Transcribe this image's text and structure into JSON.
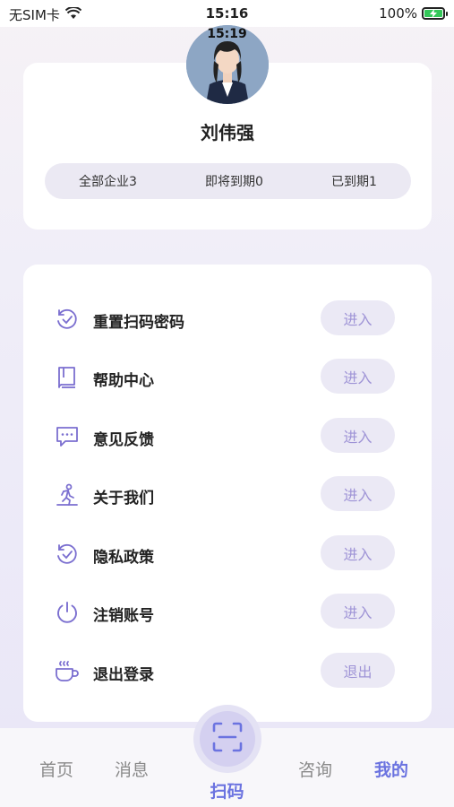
{
  "status_bar": {
    "carrier": "无SIM卡",
    "time": "15:16",
    "battery": "100%"
  },
  "profile": {
    "overlay_time": "15:19",
    "name": "刘伟强",
    "stats": [
      {
        "label": "全部企业3"
      },
      {
        "label": "即将到期0"
      },
      {
        "label": "已到期1"
      }
    ]
  },
  "menu": {
    "items": [
      {
        "label": "重置扫码密码",
        "button": "进入",
        "icon": "reset-check-icon"
      },
      {
        "label": "帮助中心",
        "button": "进入",
        "icon": "book-icon"
      },
      {
        "label": "意见反馈",
        "button": "进入",
        "icon": "chat-bubble-icon"
      },
      {
        "label": "关于我们",
        "button": "进入",
        "icon": "running-person-icon"
      },
      {
        "label": "隐私政策",
        "button": "进入",
        "icon": "privacy-check-icon"
      },
      {
        "label": "注销账号",
        "button": "进入",
        "icon": "power-icon"
      },
      {
        "label": "退出登录",
        "button": "退出",
        "icon": "coffee-cup-icon"
      }
    ]
  },
  "tab_bar": {
    "home": "首页",
    "messages": "消息",
    "scan": "扫码",
    "consult": "咨询",
    "mine": "我的"
  },
  "colors": {
    "accent": "#6b73e0",
    "button_bg": "#ebe9f5",
    "button_text": "#9e93d6",
    "icon": "#7b6fd0"
  }
}
